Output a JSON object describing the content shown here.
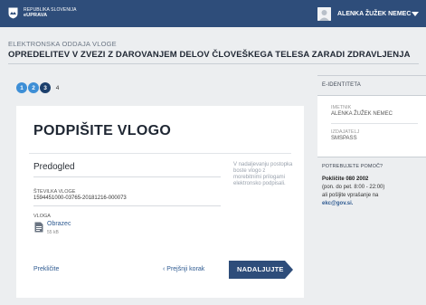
{
  "header": {
    "brand_line1": "REPUBLIKA SLOVENIJA",
    "brand_line2": "eUPRAVA",
    "user_name": "ALENKA ŽUŽEK NEMEC",
    "colors": {
      "topbar": "#2e4d7a"
    }
  },
  "page": {
    "section_label": "ELEKTRONSKA ODDAJA VLOGE",
    "heading": "OPREDELITEV V ZVEZI Z DAROVANJEM DELOV ČLOVEŠKEGA TELESA ZARADI ZDRAVLJENJA"
  },
  "steps": {
    "items": [
      "1",
      "2",
      "3",
      "4"
    ],
    "current": 3
  },
  "card": {
    "title": "PODPIŠITE VLOGO",
    "preview_heading": "Predogled",
    "number_label": "ŠTEVILKA VLOGE",
    "number_value": "1594451000-03765-20181216-000073",
    "vloga_label": "VLOGA",
    "document_name": "Obrazec",
    "document_size": "55 kB",
    "side_note": "V nadaljevanju postopka boste vlogo z morebitnimi prilogami elektronsko podpisali.",
    "cancel_label": "Prekličite",
    "back_label": "‹ Prejšnji korak",
    "next_label": "NADALJUJTE",
    "colors": {
      "next_button": "#2e4d7a"
    }
  },
  "identity": {
    "heading": "E-IDENTITETA",
    "holder_label": "IMETNIK",
    "holder_value": "ALENKA ŽUŽEK NEMEC",
    "issuer_label": "IZDAJATELJ",
    "issuer_value": "SMSPASS"
  },
  "help": {
    "heading": "POTREBUJETE POMOČ?",
    "phone": "Pokličite 080 2002",
    "hours": "(pon. do pet. 8:00 - 22:00)",
    "mail_text": "ali pošljite vprašanje na",
    "email": "ekc@gov.si."
  }
}
